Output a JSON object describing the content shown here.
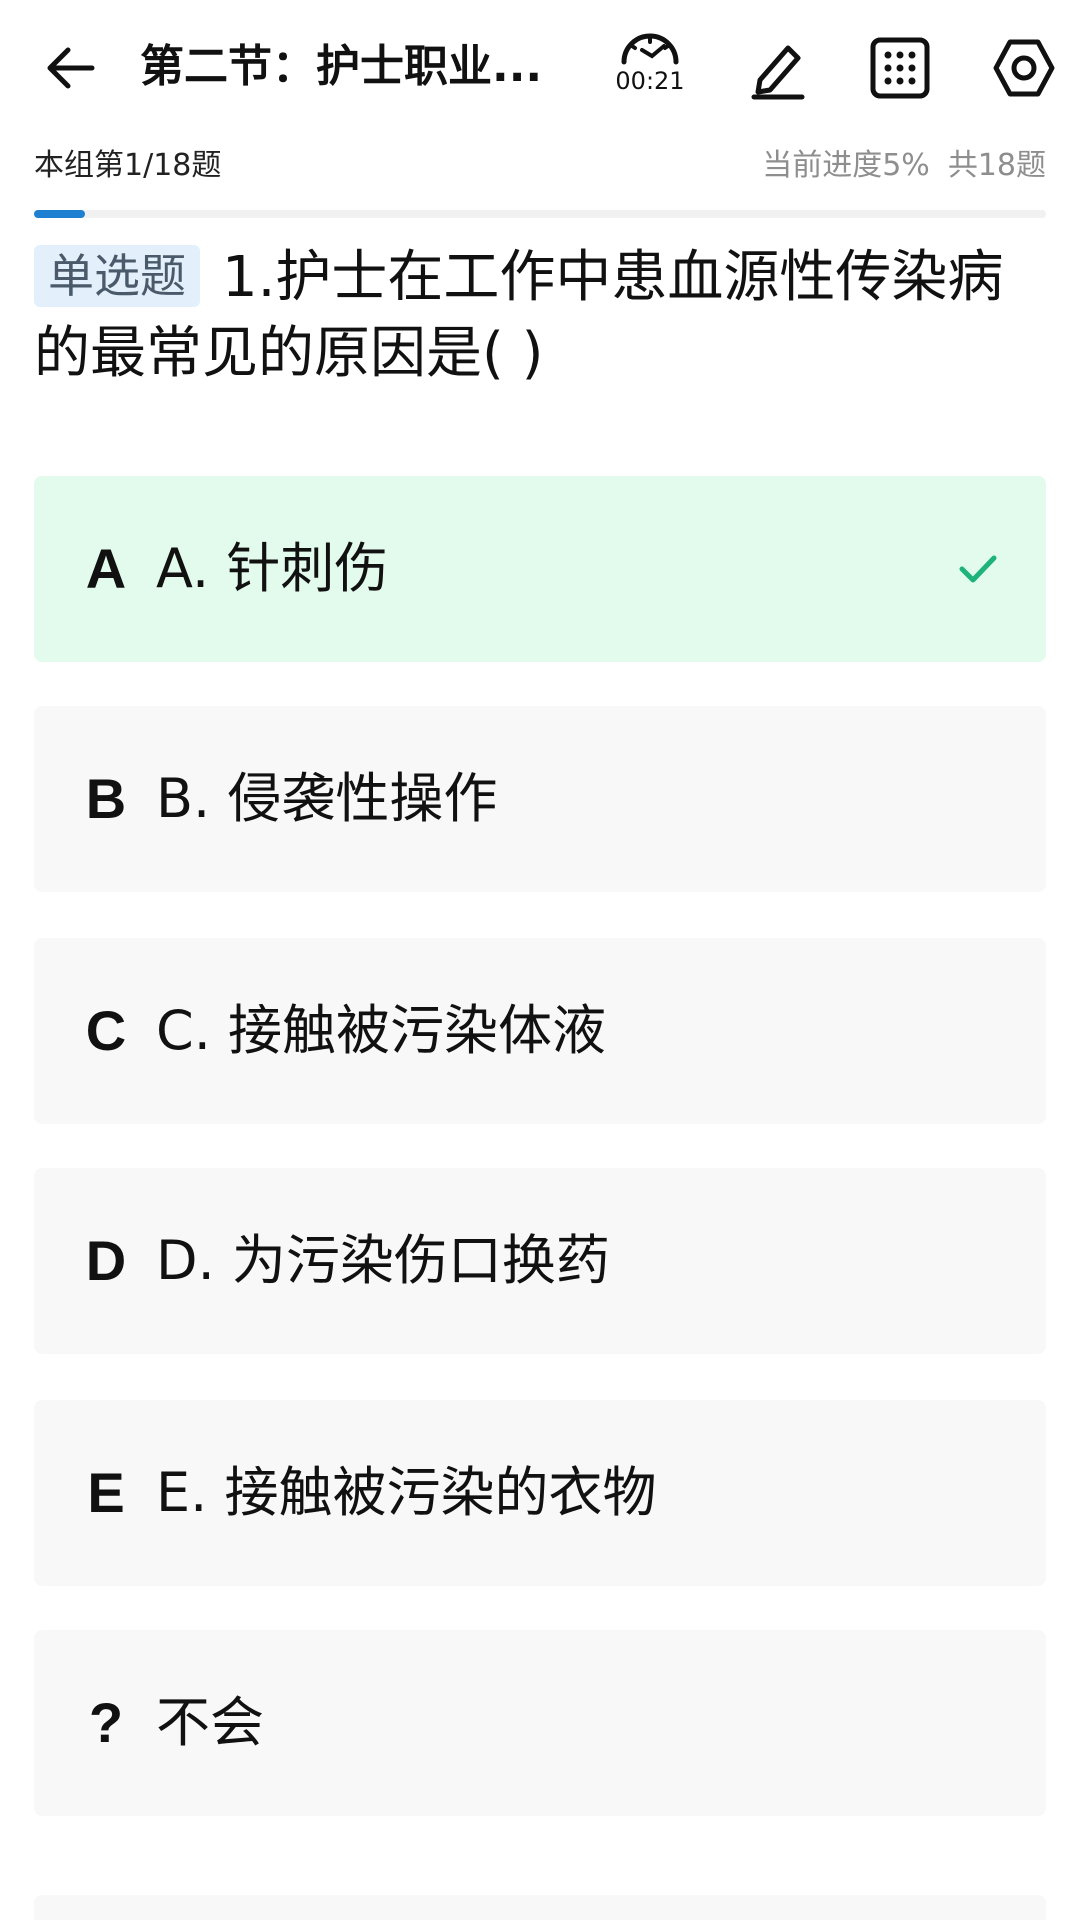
{
  "header": {
    "title": "第二节：护士职业...",
    "timer": "00:21",
    "icons": [
      "back-arrow-icon",
      "timer-icon",
      "edit-pencil-icon",
      "answer-grid-icon",
      "settings-icon"
    ]
  },
  "progress": {
    "group_label": "本组第1/18题",
    "current_progress": "当前进度5%",
    "total": "共18题",
    "percent": 5
  },
  "question": {
    "type_badge": "单选题",
    "text": "1.护士在工作中患血源性传染病的最常见的原因是( )"
  },
  "options": [
    {
      "letter": "A",
      "text": "A. 针刺伤",
      "selected": true
    },
    {
      "letter": "B",
      "text": "B. 侵袭性操作",
      "selected": false
    },
    {
      "letter": "C",
      "text": "C. 接触被污染体液",
      "selected": false
    },
    {
      "letter": "D",
      "text": "D. 为污染伤口换药",
      "selected": false
    },
    {
      "letter": "E",
      "text": "E. 接触被污染的衣物",
      "selected": false
    },
    {
      "letter": "?",
      "text": "不会",
      "selected": false
    }
  ],
  "colors": {
    "accent": "#1f7fd1",
    "selected_bg": "#e2fbec",
    "check": "#1db37a",
    "option_bg": "#f8f8f8",
    "badge_bg": "#e3f0fb"
  }
}
